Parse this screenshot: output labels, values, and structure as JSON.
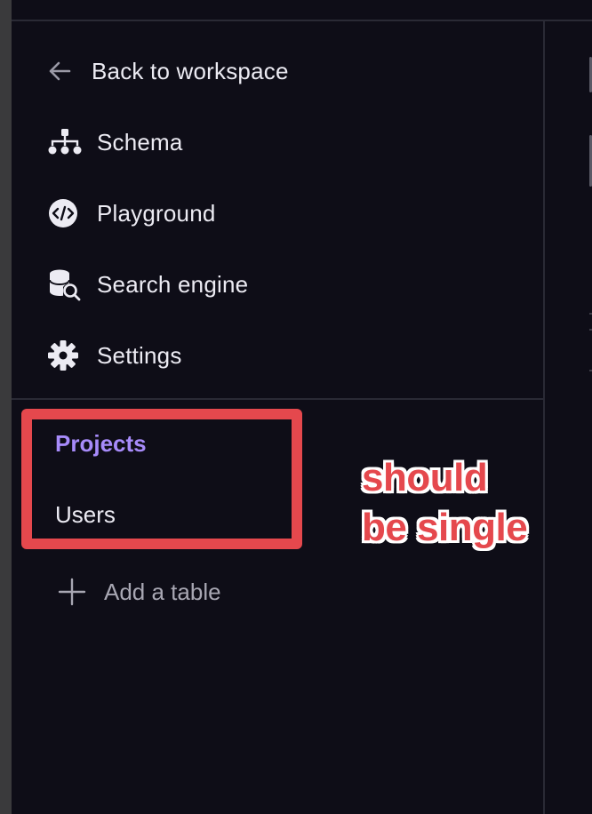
{
  "sidebar": {
    "back_label": "Back to workspace",
    "nav": [
      {
        "label": "Schema",
        "icon": "schema-icon"
      },
      {
        "label": "Playground",
        "icon": "code-icon"
      },
      {
        "label": "Search engine",
        "icon": "database-search-icon"
      },
      {
        "label": "Settings",
        "icon": "gear-icon"
      }
    ],
    "tables": [
      {
        "label": "Projects",
        "active": true
      },
      {
        "label": "Users",
        "active": false
      }
    ],
    "add_table_label": "Add a table"
  },
  "annotation": {
    "line1": "should",
    "line2": "be single",
    "color": "#e5484d"
  },
  "colors": {
    "background": "#0e0d17",
    "accent": "#a78bfa",
    "text": "#ecebf3",
    "muted": "#a8a7b3",
    "annotation_red": "#e5484d"
  }
}
